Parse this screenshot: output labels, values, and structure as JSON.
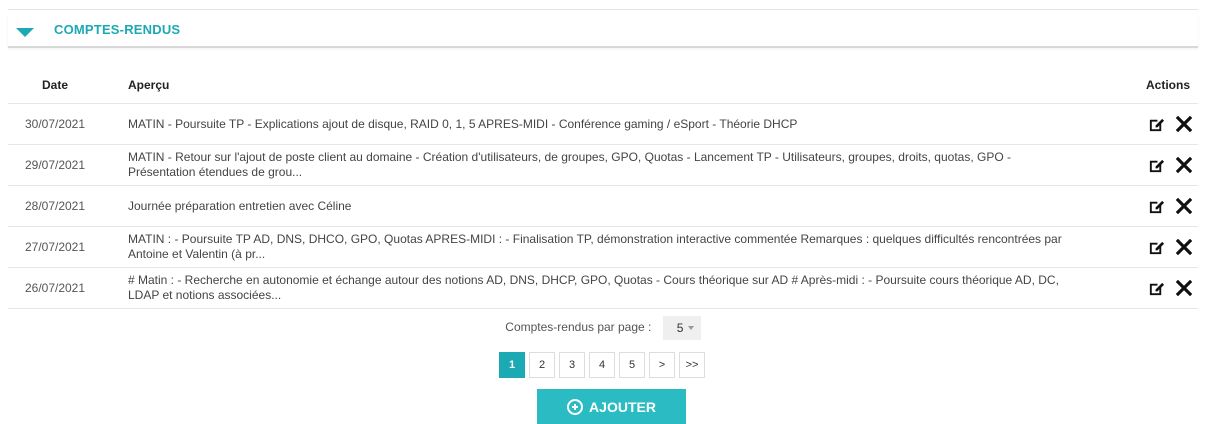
{
  "section": {
    "title": "COMPTES-RENDUS"
  },
  "table": {
    "headers": {
      "date": "Date",
      "preview": "Aperçu",
      "actions": "Actions"
    },
    "rows": [
      {
        "date": "30/07/2021",
        "preview": "MATIN - Poursuite TP - Explications ajout de disque, RAID 0, 1, 5 APRES-MIDI - Conférence gaming / eSport - Théorie DHCP"
      },
      {
        "date": "29/07/2021",
        "preview": "MATIN - Retour sur l'ajout de poste client au domaine - Création d'utilisateurs, de groupes, GPO, Quotas - Lancement TP - Utilisateurs, groupes, droits, quotas, GPO - Présentation étendues de grou..."
      },
      {
        "date": "28/07/2021",
        "preview": "Journée préparation entretien avec Céline"
      },
      {
        "date": "27/07/2021",
        "preview": "MATIN : - Poursuite TP AD, DNS, DHCO, GPO, Quotas APRES-MIDI : - Finalisation TP, démonstration interactive commentée Remarques : quelques difficultés rencontrées par Antoine et Valentin (à pr..."
      },
      {
        "date": "26/07/2021",
        "preview": "# Matin : - Recherche en autonomie et échange autour des notions AD, DNS, DHCP, GPO, Quotas - Cours théorique sur AD # Après-midi : - Poursuite cours théorique AD, DC, LDAP et notions associées..."
      }
    ]
  },
  "pagination": {
    "per_page_label": "Comptes-rendus par page :",
    "per_page_value": "5",
    "pages": [
      "1",
      "2",
      "3",
      "4",
      "5",
      ">",
      ">>"
    ],
    "current_page": "1"
  },
  "add_button": {
    "label": "AJOUTER"
  },
  "colors": {
    "accent": "#1ba9b4",
    "button": "#2bbbc3"
  }
}
